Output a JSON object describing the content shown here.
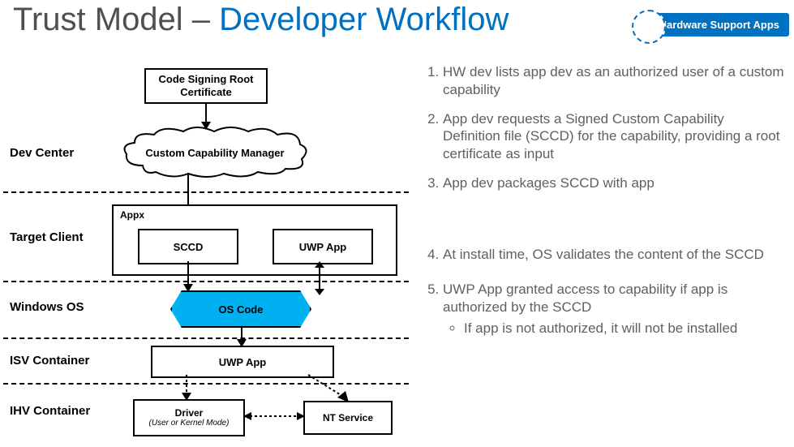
{
  "title": {
    "plain": "Trust Model –",
    "accent": "Developer Workflow"
  },
  "badge": "Hardware Support Apps",
  "rows": {
    "devcenter": "Dev Center",
    "target": "Target Client",
    "winos": "Windows OS",
    "isv": "ISV Container",
    "ihv": "IHV Container"
  },
  "boxes": {
    "csr_l1": "Code Signing Root",
    "csr_l2": "Certificate",
    "ccm": "Custom Capability Manager",
    "appx_label": "Appx",
    "sccd": "SCCD",
    "uwp1": "UWP App",
    "oscode": "OS Code",
    "uwp2": "UWP App",
    "driver_l1": "Driver",
    "driver_l2": "(User or Kernel Mode)",
    "ntservice": "NT Service"
  },
  "steps": {
    "s1": "HW dev lists app dev as an authorized user of a custom capability",
    "s2": "App dev requests a Signed Custom Capability Definition file (SCCD) for the capability, providing a root certificate as input",
    "s3": "App dev packages SCCD with app",
    "s4": "At install time, OS validates the content of the SCCD",
    "s5": "UWP App granted access to capability if app is authorized by the SCCD",
    "s5a": "If app is not authorized, it will not be installed"
  }
}
